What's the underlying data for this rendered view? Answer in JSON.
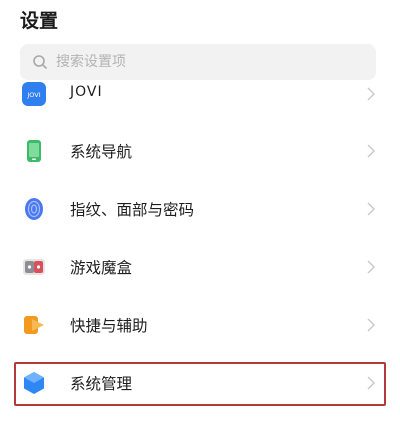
{
  "header": {
    "title": "设置"
  },
  "search": {
    "placeholder": "搜索设置项",
    "icon": "search-icon"
  },
  "settings_items": [
    {
      "label": "JOVI",
      "icon": "jovi-icon",
      "icon_text": "JOVI",
      "color": "#2f7ff0"
    },
    {
      "label": "系统导航",
      "icon": "phone-navigation-icon",
      "color": "#3dbb6b"
    },
    {
      "label": "指纹、面部与密码",
      "icon": "fingerprint-icon",
      "color": "#4a78f0"
    },
    {
      "label": "游戏魔盒",
      "icon": "game-box-icon",
      "color": "#d9505a"
    },
    {
      "label": "快捷与辅助",
      "icon": "shortcut-icon",
      "color": "#f39a1e"
    },
    {
      "label": "系统管理",
      "icon": "system-management-icon",
      "color": "#2f86f5"
    }
  ],
  "highlight_color": "#b23a3a"
}
